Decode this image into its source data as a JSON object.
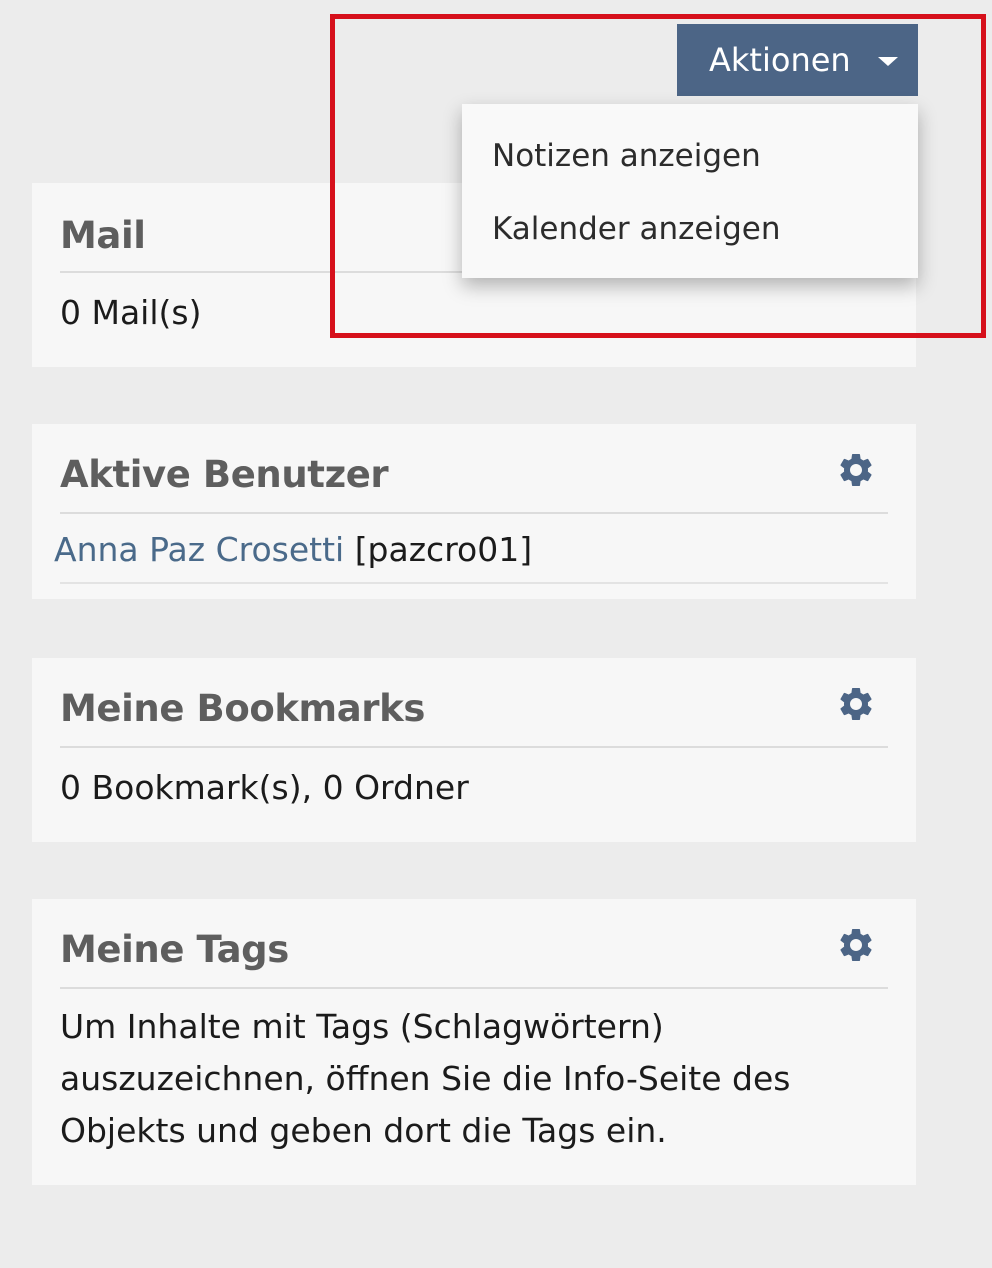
{
  "actions": {
    "button_label": "Aktionen",
    "menu_items": [
      "Notizen anzeigen",
      "Kalender anzeigen"
    ]
  },
  "panels": {
    "mail": {
      "title": "Mail",
      "body": "0 Mail(s)"
    },
    "active_users": {
      "title": "Aktive Benutzer",
      "user_name": "Anna Paz Crosetti",
      "user_login": "[pazcro01]",
      "settings_icon": "gear-icon"
    },
    "bookmarks": {
      "title": "Meine Bookmarks",
      "body": "0 Bookmark(s), 0 Ordner",
      "settings_icon": "gear-icon"
    },
    "tags": {
      "title": "Meine Tags",
      "body": "Um Inhalte mit Tags (Schlagwörtern) auszuzeichnen, öffnen Sie die Info-Seite des Objekts und geben dort die Tags ein.",
      "settings_icon": "gear-icon"
    }
  },
  "colors": {
    "page_bg": "#ececec",
    "panel_bg": "#f7f7f7",
    "action_button": "#4c6586",
    "link": "#4a6a8a",
    "highlight_frame": "#d6101b",
    "gear": "#4c6586"
  }
}
